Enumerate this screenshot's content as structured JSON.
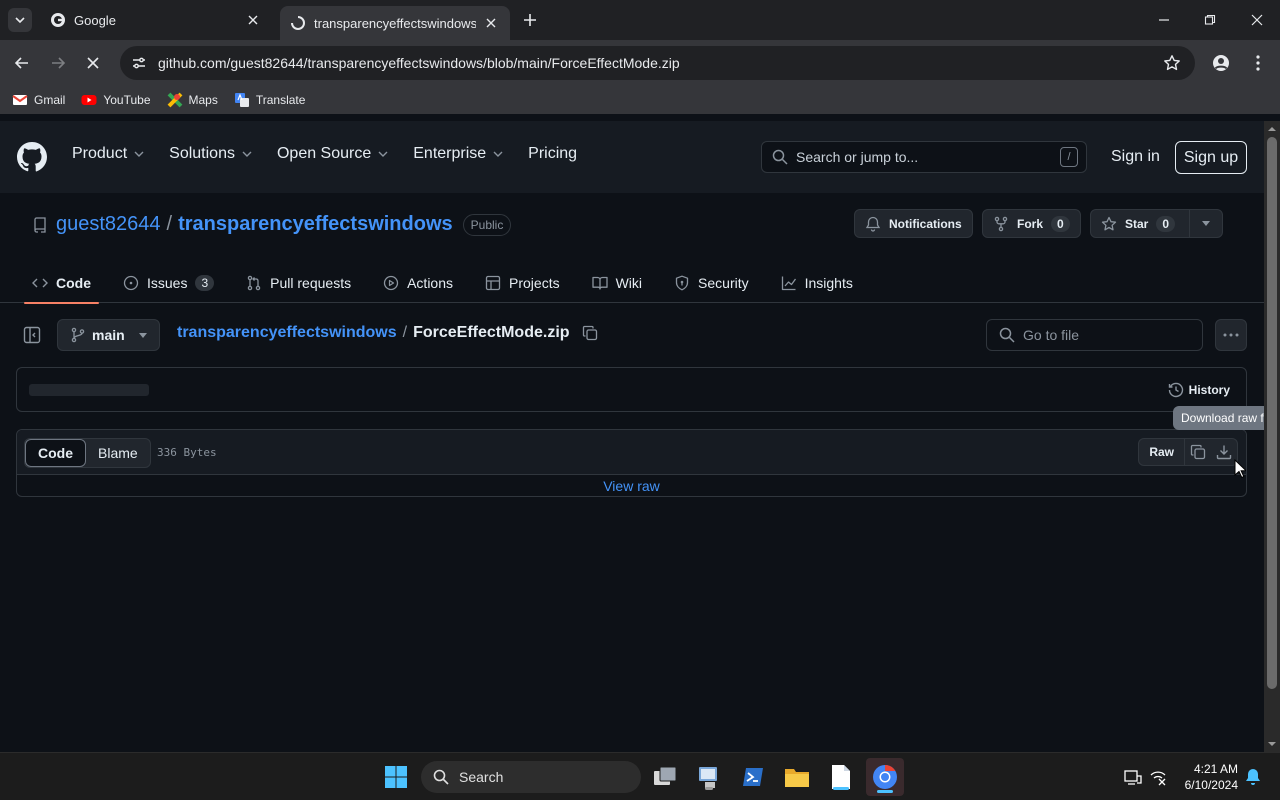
{
  "browser": {
    "tabs": [
      {
        "title": "Google",
        "active": false
      },
      {
        "title": "transparencyeffectswindows/Fo",
        "active": true
      }
    ],
    "url": "github.com/guest82644/transparencyeffectswindows/blob/main/ForceEffectMode.zip",
    "bookmarks": [
      "Gmail",
      "YouTube",
      "Maps",
      "Translate"
    ]
  },
  "github": {
    "nav": [
      "Product",
      "Solutions",
      "Open Source",
      "Enterprise",
      "Pricing"
    ],
    "search_placeholder": "Search or jump to...",
    "search_key": "/",
    "sign_in": "Sign in",
    "sign_up": "Sign up",
    "repo": {
      "owner": "guest82644",
      "separator": "/",
      "name": "transparencyeffectswindows",
      "visibility": "Public",
      "notifications": "Notifications",
      "fork_label": "Fork",
      "fork_count": "0",
      "star_label": "Star",
      "star_count": "0"
    },
    "tabs": [
      {
        "label": "Code",
        "icon": "code-icon",
        "selected": true
      },
      {
        "label": "Issues",
        "icon": "issue-icon",
        "badge": "3"
      },
      {
        "label": "Pull requests",
        "icon": "pull-request-icon"
      },
      {
        "label": "Actions",
        "icon": "play-icon"
      },
      {
        "label": "Projects",
        "icon": "table-icon"
      },
      {
        "label": "Wiki",
        "icon": "book-icon"
      },
      {
        "label": "Security",
        "icon": "shield-icon"
      },
      {
        "label": "Insights",
        "icon": "graph-icon"
      }
    ],
    "file": {
      "branch": "main",
      "repo_link": "transparencyeffectswindows",
      "crumb_sep": "/",
      "filename": "ForceEffectMode.zip",
      "goto_placeholder": "Go to file",
      "history": "History",
      "tooltip": "Download raw fil",
      "view_code": "Code",
      "view_blame": "Blame",
      "size": "336 Bytes",
      "raw": "Raw",
      "view_raw": "View raw"
    }
  },
  "taskbar": {
    "search": "Search",
    "time": "4:21 AM",
    "date": "6/10/2024"
  },
  "colors": {
    "accent_link": "#4493f8",
    "tab_underline": "#f78166",
    "bg": "#0d1117",
    "header": "#161b22"
  }
}
